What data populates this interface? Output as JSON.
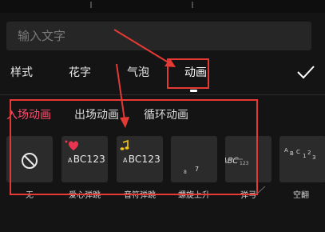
{
  "input": {
    "placeholder": "输入文字",
    "value": ""
  },
  "tabs": [
    {
      "label": "样式",
      "active": false
    },
    {
      "label": "花字",
      "active": false
    },
    {
      "label": "气泡",
      "active": false
    },
    {
      "label": "动画",
      "active": true
    }
  ],
  "subtabs": [
    {
      "label": "入场动画",
      "active": true
    },
    {
      "label": "出场动画",
      "active": false
    },
    {
      "label": "循环动画",
      "active": false
    }
  ],
  "animations": [
    {
      "label": "无",
      "icon": "none-icon"
    },
    {
      "label": "爱心弹跳",
      "icon": "heart-bounce-preview",
      "sample": "ABC123"
    },
    {
      "label": "音符弹跳",
      "icon": "note-bounce-preview",
      "sample": "ABC123"
    },
    {
      "label": "螺旋上升",
      "icon": "spiral-rise-preview"
    },
    {
      "label": "弹弓",
      "icon": "slingshot-preview"
    },
    {
      "label": "空翻",
      "icon": "flip-preview"
    }
  ],
  "colors": {
    "background": "#141414",
    "accent": "#ff4d6d",
    "annotation": "#e53935",
    "card": "#2b2b2b"
  }
}
